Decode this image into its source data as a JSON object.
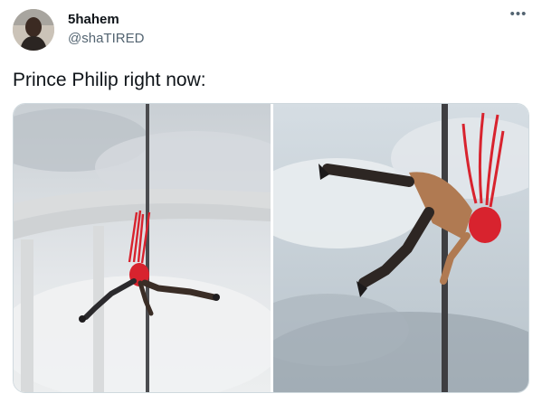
{
  "tweet": {
    "display_name": "5hahem",
    "handle": "@shaTIRED",
    "text": "Prince Philip right now:",
    "more_icon": "more-horizontal-icon"
  },
  "media": {
    "images": [
      {
        "subject": "figure-on-pole-left"
      },
      {
        "subject": "figure-on-pole-right"
      }
    ]
  },
  "colors": {
    "text": "#0f1419",
    "secondary": "#536471",
    "border": "#cfd9de",
    "figure_red": "#d8232e"
  }
}
